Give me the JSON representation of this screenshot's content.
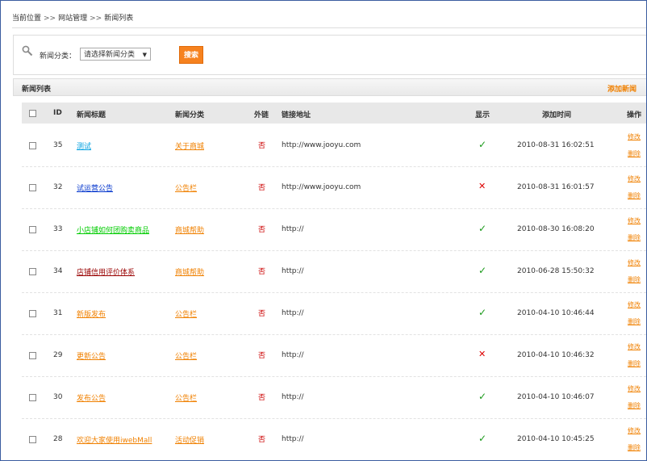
{
  "breadcrumb": {
    "items": [
      "当前位置",
      "网站管理",
      "新闻列表"
    ],
    "separator": ">>"
  },
  "search": {
    "label": "新闻分类：",
    "select_value": "请选择新闻分类",
    "button": "搜索"
  },
  "list": {
    "title": "新闻列表",
    "add_label": "添加新闻"
  },
  "columns": {
    "id": "ID",
    "title": "新闻标题",
    "category": "新闻分类",
    "external": "外链",
    "url": "链接地址",
    "display": "显示",
    "time": "添加时间",
    "ops": "操作"
  },
  "rows": [
    {
      "id": "35",
      "title": "测试",
      "title_color": "#00a0e0",
      "category": "关于商城",
      "external": "否",
      "url": "http://www.jooyu.com",
      "display": "✓",
      "display_ok": true,
      "time": "2010-08-31 16:02:51",
      "edit": "修改",
      "del": "删除"
    },
    {
      "id": "32",
      "title": "试运营公告",
      "title_color": "#0033cc",
      "category": "公告栏",
      "external": "否",
      "url": "http://www.jooyu.com",
      "display": "✕",
      "display_ok": false,
      "time": "2010-08-31 16:01:57",
      "edit": "修改",
      "del": "删除"
    },
    {
      "id": "33",
      "title": "小店铺如何团购卖商品",
      "title_color": "#00cc00",
      "category": "商城帮助",
      "external": "否",
      "url": "http://",
      "display": "✓",
      "display_ok": true,
      "time": "2010-08-30 16:08:20",
      "edit": "修改",
      "del": "删除"
    },
    {
      "id": "34",
      "title": "店铺信用评价体系",
      "title_color": "#990000",
      "category": "商城帮助",
      "external": "否",
      "url": "http://",
      "display": "✓",
      "display_ok": true,
      "time": "2010-06-28 15:50:32",
      "edit": "修改",
      "del": "删除"
    },
    {
      "id": "31",
      "title": "新版发布",
      "title_color": "#f08000",
      "category": "公告栏",
      "external": "否",
      "url": "http://",
      "display": "✓",
      "display_ok": true,
      "time": "2010-04-10 10:46:44",
      "edit": "修改",
      "del": "删除"
    },
    {
      "id": "29",
      "title": "更新公告",
      "title_color": "#f08000",
      "category": "公告栏",
      "external": "否",
      "url": "http://",
      "display": "✕",
      "display_ok": false,
      "time": "2010-04-10 10:46:32",
      "edit": "修改",
      "del": "删除"
    },
    {
      "id": "30",
      "title": "发布公告",
      "title_color": "#f08000",
      "category": "公告栏",
      "external": "否",
      "url": "http://",
      "display": "✓",
      "display_ok": true,
      "time": "2010-04-10 10:46:07",
      "edit": "修改",
      "del": "删除"
    },
    {
      "id": "28",
      "title": "欢迎大家使用iwebMall",
      "title_color": "#f08000",
      "category": "活动促销",
      "external": "否",
      "url": "http://",
      "display": "✓",
      "display_ok": true,
      "time": "2010-04-10 10:45:25",
      "edit": "修改",
      "del": "删除"
    }
  ],
  "colors": {
    "accent": "#f08000",
    "button": "#f6821f",
    "ok": "#1a9a1a",
    "no": "#dd0000",
    "border": "#3b5da0"
  }
}
